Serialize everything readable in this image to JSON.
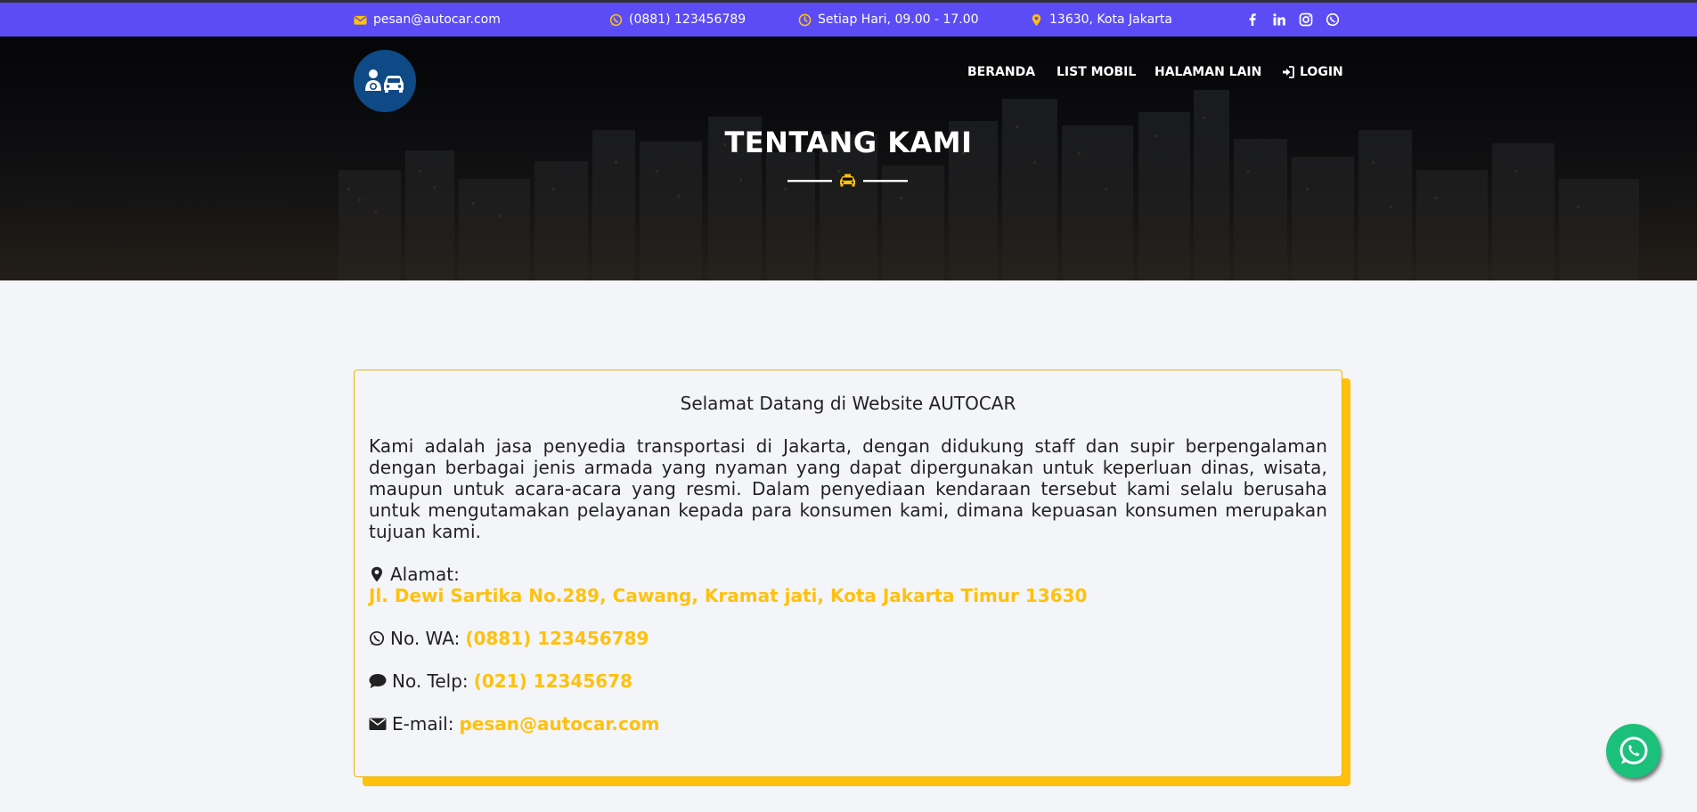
{
  "topbar": {
    "email": "pesan@autocar.com",
    "phone": "(0881) 123456789",
    "hours": "Setiap Hari, 09.00 - 17.00",
    "location": "13630, Kota Jakarta",
    "social": [
      "facebook-icon",
      "linkedin-icon",
      "instagram-icon",
      "whatsapp-icon"
    ]
  },
  "nav": {
    "items": [
      {
        "label": "BERANDA"
      },
      {
        "label": "LIST MOBIL"
      },
      {
        "label": "HALAMAN LAIN"
      },
      {
        "label": "LOGIN"
      }
    ]
  },
  "hero": {
    "title": "TENTANG KAMI",
    "divider_icon": "taxi-icon"
  },
  "about": {
    "title": "Selamat Datang di Website AUTOCAR",
    "body": "Kami adalah jasa penyedia transportasi di Jakarta, dengan didukung staff dan supir berpengalaman dengan berbagai jenis armada yang nyaman yang dapat dipergunakan untuk keperluan dinas, wisata, maupun untuk acara-acara yang resmi. Dalam penyediaan kendaraan tersebut kami selalu berusaha untuk mengutamakan pelayanan kepada para konsumen kami, dimana kepuasan konsumen merupakan tujuan kami.",
    "address_label": "Alamat:",
    "address_value": "Jl. Dewi Sartika No.289, Cawang, Kramat jati, Kota Jakarta Timur 13630",
    "wa_label": "No. WA:",
    "wa_value": "(0881) 123456789",
    "telp_label": "No. Telp:",
    "telp_value": "(021) 12345678",
    "email_label": "E-mail:",
    "email_value": "pesan@autocar.com"
  },
  "colors": {
    "topbar": "#5b4cf5",
    "accent": "#ffc10e",
    "logo_bg": "#0f4a86",
    "whatsapp": "#1bc07a"
  }
}
